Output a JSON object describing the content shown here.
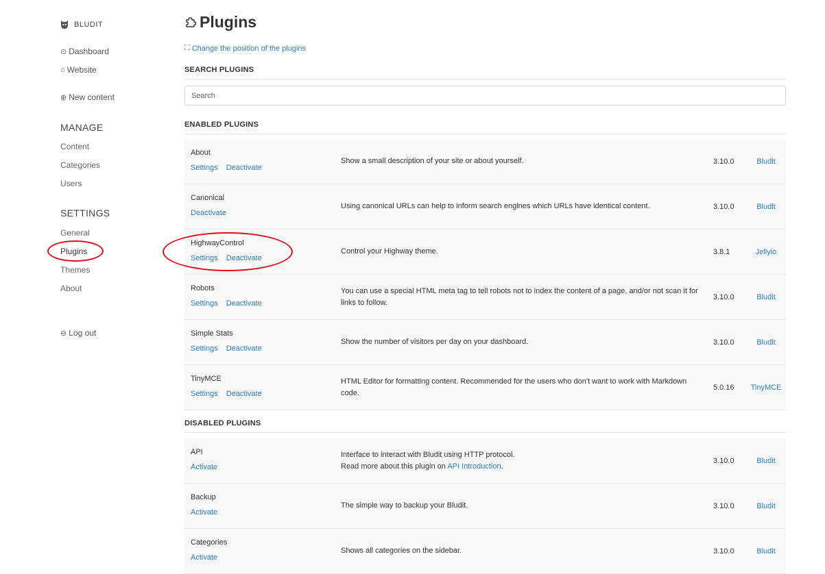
{
  "sidebar": {
    "brand": "BLUDIT",
    "top_links": [
      {
        "icon": "dashboard-icon",
        "glyph": "⊙",
        "label": "Dashboard"
      },
      {
        "icon": "home-icon",
        "glyph": "⌂",
        "label": "Website"
      }
    ],
    "new_content": {
      "icon": "plus-circle-icon",
      "glyph": "⊕",
      "label": "New content"
    },
    "manage_heading": "MANAGE",
    "manage_items": [
      "Content",
      "Categories",
      "Users"
    ],
    "settings_heading": "SETTINGS",
    "settings_items": [
      "General",
      "Plugins",
      "Themes",
      "About"
    ],
    "logout": {
      "icon": "logout-icon",
      "glyph": "⊖",
      "label": "Log out"
    }
  },
  "main": {
    "title": "Plugins",
    "change_position": "Change the position of the plugins",
    "search_heading": "SEARCH PLUGINS",
    "search_placeholder": "Search",
    "enabled_heading": "ENABLED PLUGINS",
    "enabled_plugins": [
      {
        "name": "About",
        "actions": [
          "Settings",
          "Deactivate"
        ],
        "desc": "Show a small description of your site or about yourself.",
        "version": "3.10.0",
        "author": "Bludit"
      },
      {
        "name": "Canonical",
        "actions": [
          "Deactivate"
        ],
        "desc": "Using canonical URLs can help to inform search engines which URLs have identical content.",
        "version": "3.10.0",
        "author": "Bludit"
      },
      {
        "name": "HighwayControl",
        "actions": [
          "Settings",
          "Deactivate"
        ],
        "desc": "Control your Highway theme.",
        "version": "3.8.1",
        "author": "Jellyio"
      },
      {
        "name": "Robots",
        "actions": [
          "Settings",
          "Deactivate"
        ],
        "desc": "You can use a special HTML meta tag to tell robots not to index the content of a page, and/or not scan it for links to follow.",
        "version": "3.10.0",
        "author": "Bludit"
      },
      {
        "name": "Simple Stats",
        "actions": [
          "Settings",
          "Deactivate"
        ],
        "desc": "Show the number of visitors per day on your dashboard.",
        "version": "3.10.0",
        "author": "Bludit"
      },
      {
        "name": "TinyMCE",
        "actions": [
          "Settings",
          "Deactivate"
        ],
        "desc": "HTML Editor for formatting content. Recommended for the users who don't want to work with Markdown code.",
        "version": "5.0.16",
        "author": "TinyMCE"
      }
    ],
    "disabled_heading": "DISABLED PLUGINS",
    "disabled_plugins": [
      {
        "name": "API",
        "actions": [
          "Activate"
        ],
        "desc_line1": "Interface to interact with Bludit using HTTP protocol.",
        "desc_prefix": "Read more about this plugin on ",
        "desc_link": "API Introduction",
        "desc_suffix": ".",
        "version": "3.10.0",
        "author": "Bludit"
      },
      {
        "name": "Backup",
        "actions": [
          "Activate"
        ],
        "desc": "The simple way to backup your Bludit.",
        "version": "3.10.0",
        "author": "Bludit"
      },
      {
        "name": "Categories",
        "actions": [
          "Activate"
        ],
        "desc": "Shows all categories on the sidebar.",
        "version": "3.10.0",
        "author": "Bludit"
      }
    ]
  },
  "colors": {
    "link": "#2c7fc4",
    "annotation": "#e0101c",
    "row_bg": "#f8f8f8"
  }
}
